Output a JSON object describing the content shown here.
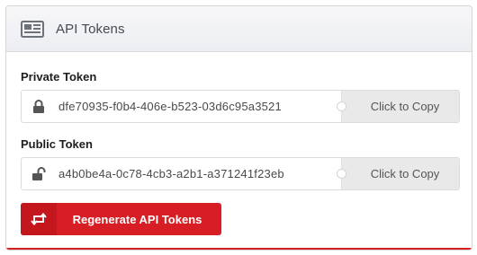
{
  "panel": {
    "title": "API Tokens",
    "header_icon": "newspaper-icon"
  },
  "private_token": {
    "label": "Private Token",
    "icon": "lock-closed-icon",
    "value": "dfe70935-f0b4-406e-b523-03d6c95a3521",
    "copy_label": "Click to Copy"
  },
  "public_token": {
    "label": "Public Token",
    "icon": "lock-open-icon",
    "value": "a4b0be4a-0c78-4cb3-a2b1-a371241f23eb",
    "copy_label": "Click to Copy"
  },
  "regenerate": {
    "label": "Regenerate API Tokens",
    "icon": "retweet-icon"
  },
  "colors": {
    "accent": "#d81e25",
    "accent_dark": "#c4161d",
    "header_bg": "#eceef1",
    "copy_bg": "#e9e9e9"
  }
}
